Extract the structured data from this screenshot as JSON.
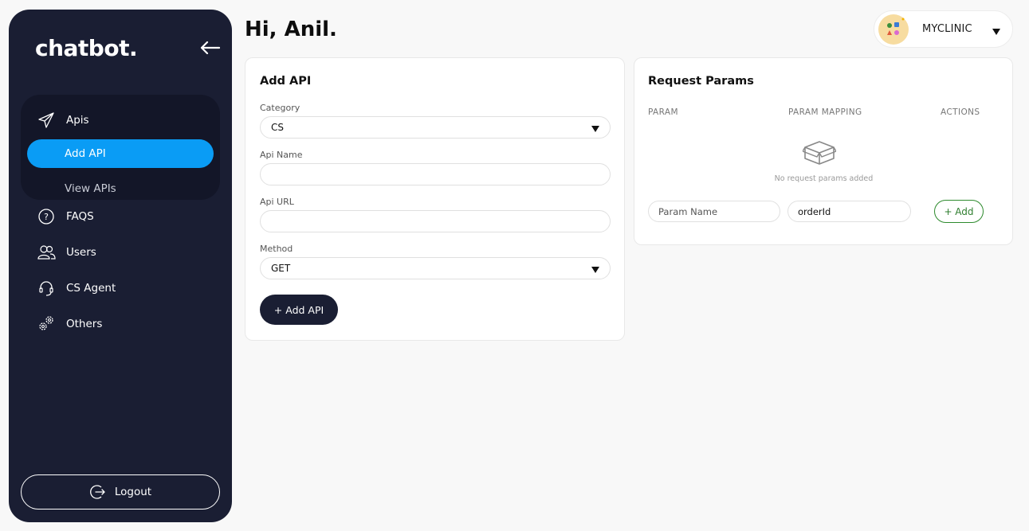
{
  "sidebar": {
    "brand": "chatbot.",
    "nav": {
      "apis": "Apis",
      "add_api": "Add API",
      "view_apis": "View APIs",
      "faqs": "FAQS",
      "users": "Users",
      "cs_agent": "CS Agent",
      "others": "Others"
    },
    "logout": "Logout"
  },
  "header": {
    "greeting": "Hi, Anil.",
    "org_name": "MYCLINIC"
  },
  "add_api": {
    "title": "Add API",
    "category_label": "Category",
    "category_value": "CS",
    "api_name_label": "Api Name",
    "api_name_value": "",
    "api_url_label": "Api URL",
    "api_url_value": "",
    "method_label": "Method",
    "method_value": "GET",
    "submit_label": "+ Add API"
  },
  "request_params": {
    "title": "Request Params",
    "columns": [
      "PARAM",
      "PARAM MAPPING",
      "ACTIONS"
    ],
    "empty_text": "No request params added",
    "param_name_placeholder": "Param Name",
    "param_mapping_value": "orderId",
    "add_label": "+ Add"
  },
  "colors": {
    "sidebar_bg": "#1a1e33",
    "accent": "#0a9cf5",
    "add_green": "#2e8b2e"
  },
  "icons": [
    "back-arrow-icon",
    "paper-plane-icon",
    "question-icon",
    "users-icon",
    "headset-icon",
    "gears-icon",
    "logout-icon",
    "empty-box-icon",
    "caret-down-icon"
  ]
}
